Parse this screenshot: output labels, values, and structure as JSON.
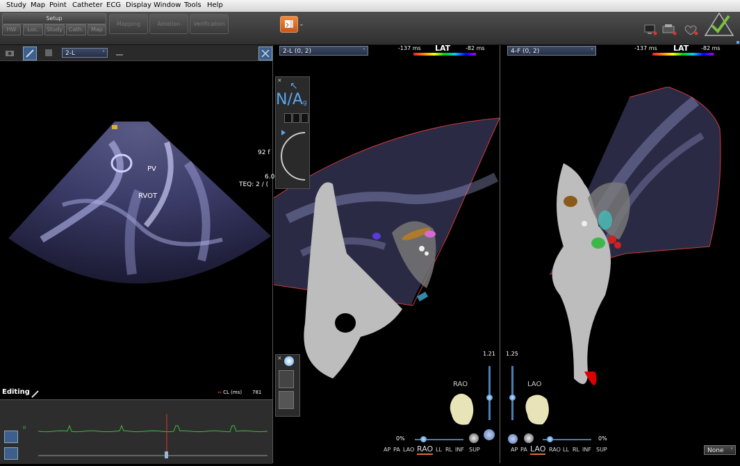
{
  "menu": {
    "items": [
      "Study",
      "Map",
      "Point",
      "Catheter",
      "ECG",
      "Display",
      "Window",
      "Tools",
      "Help"
    ]
  },
  "toolbar": {
    "setup_label": "Setup",
    "setup_tabs": [
      "HW",
      "Loc.",
      "Study",
      "Cath.",
      "Map"
    ],
    "disabled_buttons": [
      "Mapping",
      "Ablation",
      "Verification"
    ]
  },
  "left_panel": {
    "dropdown_value": "2-L",
    "labels": {
      "pv": "PV",
      "rvot": "RVOT"
    },
    "editing_label": "Editing",
    "cl_label": "CL (ms)",
    "cl_value": "781",
    "ecg_color": "#3fbf3f"
  },
  "center_panel": {
    "dropdown_value": "2-L (0, 2)",
    "lat_title": "LAT",
    "lat_min": "-137 ms",
    "lat_max": "-82 ms",
    "na_label": "N/A",
    "na_sub": "g",
    "side_text": [
      "92 f",
      "6.0",
      "TEQ: 2 / ("
    ],
    "scale_value": "1.21",
    "orientation_label": "RAO",
    "percent": "0%",
    "views": [
      "AP",
      "PA",
      "LAO",
      "RAO",
      "LL",
      "RL",
      "INF",
      "SUP"
    ],
    "active_view": "RAO"
  },
  "right_panel": {
    "dropdown_value": "4-F (0, 2)",
    "lat_title": "LAT",
    "lat_min": "-137 ms",
    "lat_max": "-82 ms",
    "scale_value": "1.25",
    "orientation_label": "LAO",
    "percent": "0%",
    "views": [
      "AP",
      "PA",
      "LAO",
      "RAO",
      "LL",
      "RL",
      "INF",
      "SUP"
    ],
    "active_view": "LAO",
    "none_select": "None"
  },
  "colors": {
    "ultrasound": "#a9abe6",
    "fan_border": "#d23b3b",
    "dropdown_bg": "#2b3650",
    "active_view_underline": "#e0703a"
  }
}
